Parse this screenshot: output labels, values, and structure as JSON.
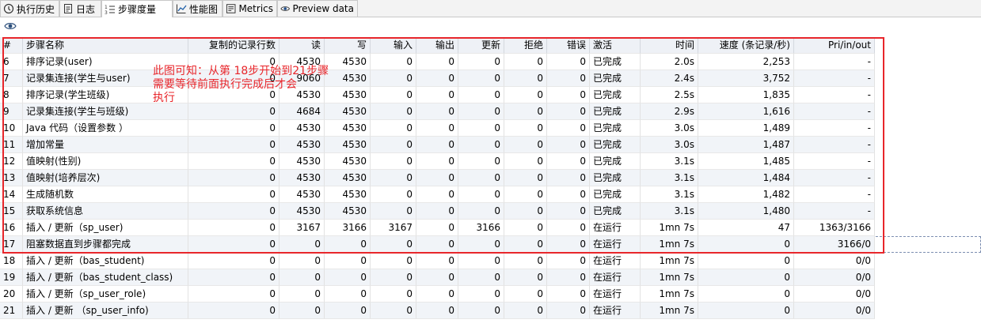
{
  "tabs": [
    {
      "label": "执行历史",
      "icon": "history-icon"
    },
    {
      "label": "日志",
      "icon": "log-icon"
    },
    {
      "label": "步骤度量",
      "icon": "step-metrics-icon"
    },
    {
      "label": "性能图",
      "icon": "chart-icon"
    },
    {
      "label": "Metrics",
      "icon": "metrics-icon"
    },
    {
      "label": "Preview data",
      "icon": "preview-eye-icon"
    }
  ],
  "toolbar": {
    "icon": "eye-icon"
  },
  "table": {
    "headers": [
      "#",
      "步骤名称",
      "复制的记录行数",
      "读",
      "写",
      "输入",
      "输出",
      "更新",
      "拒绝",
      "错误",
      "激活",
      "时间",
      "速度 (条记录/秒)",
      "Pri/in/out"
    ],
    "rows": [
      [
        "6",
        "排序记录(user)",
        "0",
        "4530",
        "4530",
        "0",
        "0",
        "0",
        "0",
        "0",
        "已完成",
        "2.0s",
        "2,253",
        "-"
      ],
      [
        "7",
        "记录集连接(学生与user)",
        "0",
        "9060",
        "4530",
        "0",
        "0",
        "0",
        "0",
        "0",
        "已完成",
        "2.4s",
        "3,752",
        "-"
      ],
      [
        "8",
        "排序记录(学生班级)",
        "0",
        "4530",
        "4530",
        "0",
        "0",
        "0",
        "0",
        "0",
        "已完成",
        "2.5s",
        "1,835",
        "-"
      ],
      [
        "9",
        "记录集连接(学生与班级)",
        "0",
        "4684",
        "4530",
        "0",
        "0",
        "0",
        "0",
        "0",
        "已完成",
        "2.9s",
        "1,616",
        "-"
      ],
      [
        "10",
        "Java 代码（设置参数 ）",
        "0",
        "4530",
        "4530",
        "0",
        "0",
        "0",
        "0",
        "0",
        "已完成",
        "3.0s",
        "1,489",
        "-"
      ],
      [
        "11",
        "增加常量",
        "0",
        "4530",
        "4530",
        "0",
        "0",
        "0",
        "0",
        "0",
        "已完成",
        "3.0s",
        "1,487",
        "-"
      ],
      [
        "12",
        "值映射(性别)",
        "0",
        "4530",
        "4530",
        "0",
        "0",
        "0",
        "0",
        "0",
        "已完成",
        "3.1s",
        "1,485",
        "-"
      ],
      [
        "13",
        "值映射(培养层次)",
        "0",
        "4530",
        "4530",
        "0",
        "0",
        "0",
        "0",
        "0",
        "已完成",
        "3.1s",
        "1,484",
        "-"
      ],
      [
        "14",
        "生成随机数",
        "0",
        "4530",
        "4530",
        "0",
        "0",
        "0",
        "0",
        "0",
        "已完成",
        "3.1s",
        "1,482",
        "-"
      ],
      [
        "15",
        "获取系统信息",
        "0",
        "4530",
        "4530",
        "0",
        "0",
        "0",
        "0",
        "0",
        "已完成",
        "3.1s",
        "1,480",
        "-"
      ],
      [
        "16",
        "插入 / 更新（sp_user)",
        "0",
        "3167",
        "3166",
        "3167",
        "0",
        "3166",
        "0",
        "0",
        "在运行",
        "1mn 7s",
        "47",
        "1363/3166"
      ],
      [
        "17",
        "阻塞数据直到步骤都完成",
        "0",
        "0",
        "0",
        "0",
        "0",
        "0",
        "0",
        "0",
        "在运行",
        "1mn 7s",
        "0",
        "3166/0"
      ],
      [
        "18",
        "插入 / 更新（bas_student)",
        "0",
        "0",
        "0",
        "0",
        "0",
        "0",
        "0",
        "0",
        "在运行",
        "1mn 7s",
        "0",
        "0/0"
      ],
      [
        "19",
        "插入 / 更新（bas_student_class)",
        "0",
        "0",
        "0",
        "0",
        "0",
        "0",
        "0",
        "0",
        "在运行",
        "1mn 7s",
        "0",
        "0/0"
      ],
      [
        "20",
        "插入 / 更新（sp_user_role)",
        "0",
        "0",
        "0",
        "0",
        "0",
        "0",
        "0",
        "0",
        "在运行",
        "1mn 7s",
        "0",
        "0/0"
      ],
      [
        "21",
        "插入 / 更新 （sp_user_info)",
        "0",
        "0",
        "0",
        "0",
        "0",
        "0",
        "0",
        "0",
        "在运行",
        "1mn 7s",
        "0",
        "0/0"
      ]
    ],
    "selected_row": "17"
  },
  "annotation": {
    "lines": [
      "此图可知：从第 18步开始到21步骤",
      "需要等待前面执行完成后才会",
      "执行"
    ],
    "color": "#e8262b"
  }
}
